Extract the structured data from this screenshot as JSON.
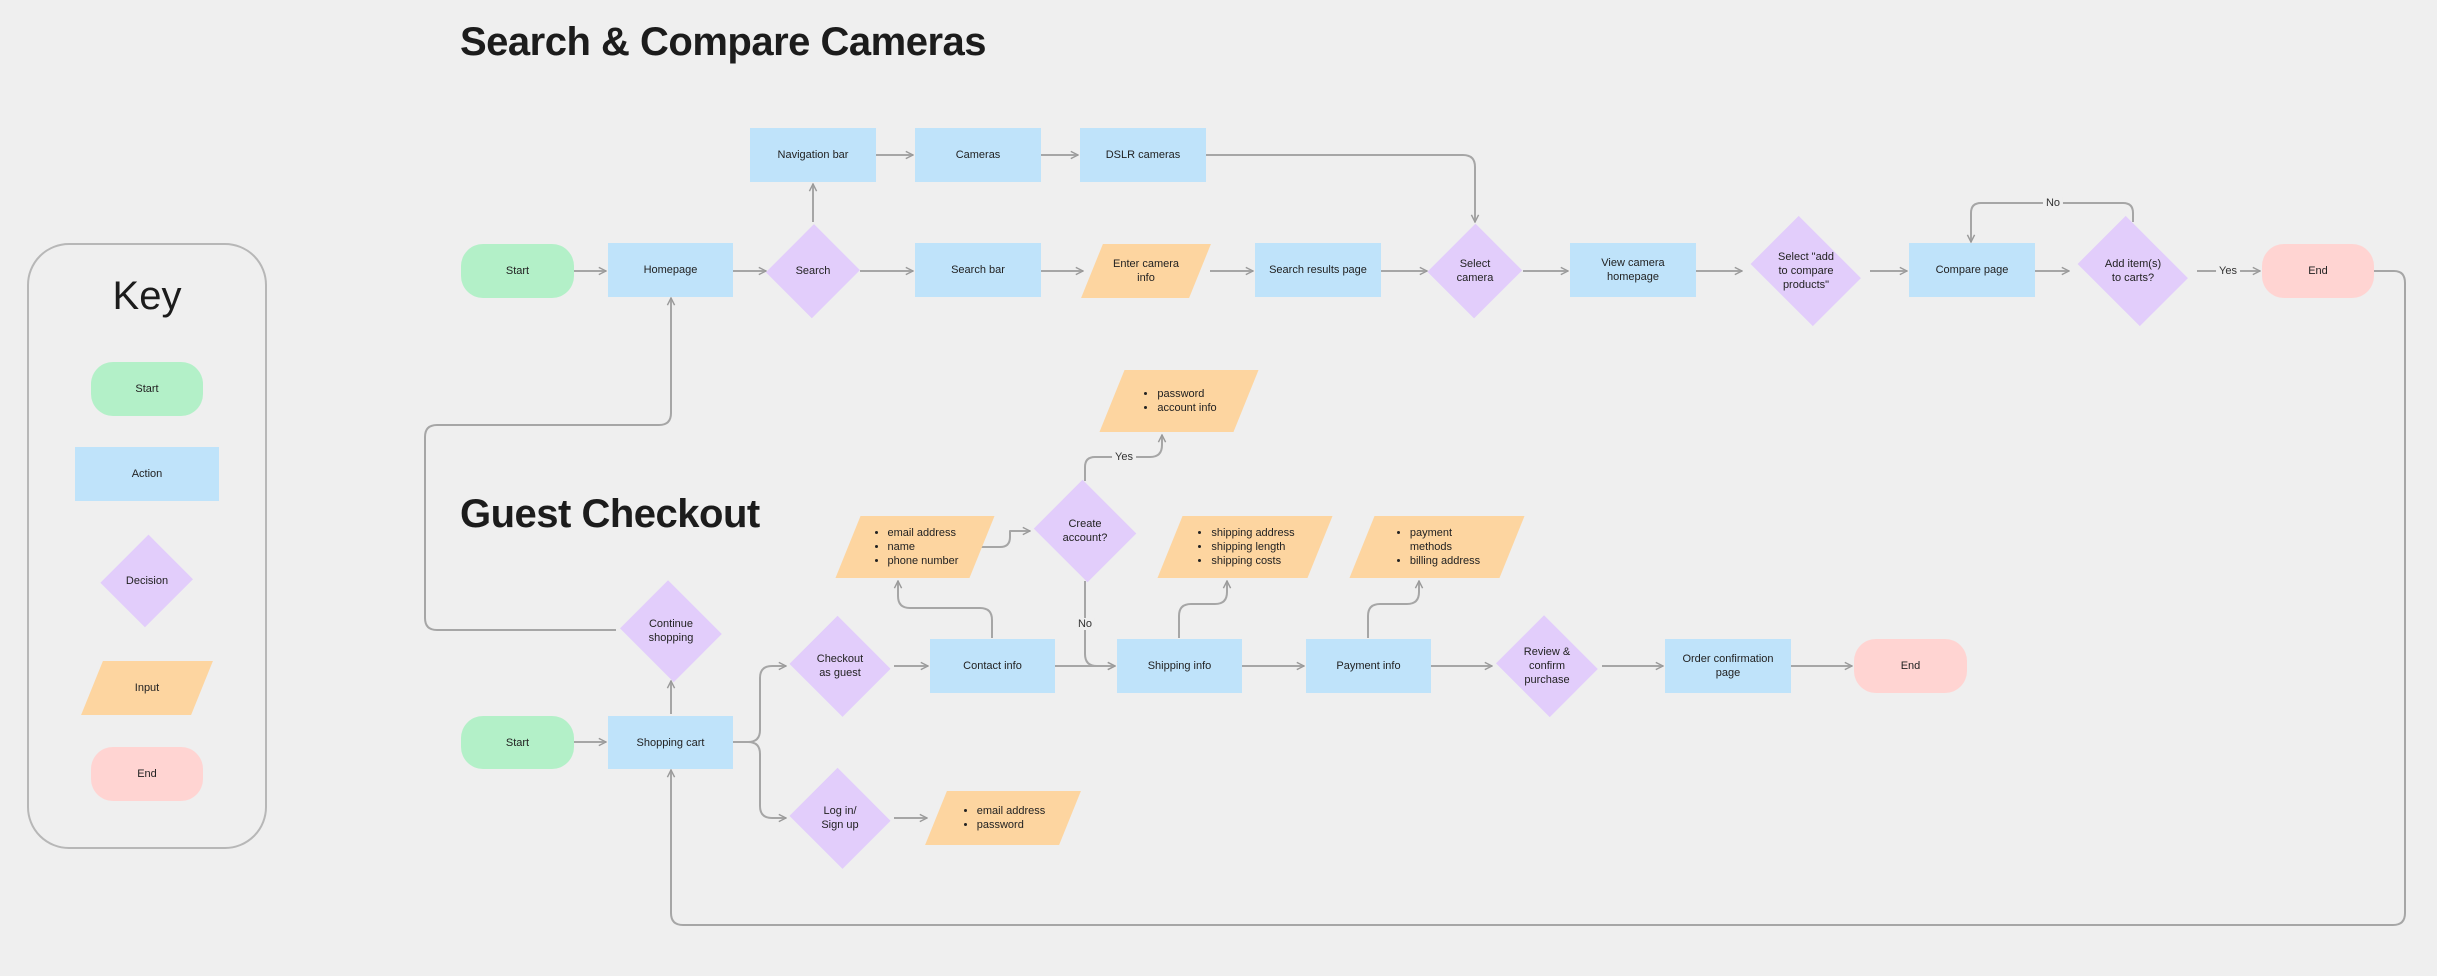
{
  "titles": {
    "search": "Search & Compare Cameras",
    "checkout": "Guest Checkout"
  },
  "key": {
    "title": "Key",
    "start": "Start",
    "action": "Action",
    "decision": "Decision",
    "input": "Input",
    "end": "End"
  },
  "search_flow": {
    "start": "Start",
    "homepage": "Homepage",
    "search": "Search",
    "navigation_bar": "Navigation bar",
    "cameras": "Cameras",
    "dslr_cameras": "DSLR cameras",
    "search_bar": "Search bar",
    "enter_camera_info": "Enter camera\ninfo",
    "search_results_page": "Search results page",
    "select_camera": "Select\ncamera",
    "view_camera_homepage": "View camera\nhomepage",
    "select_add_to_compare": "Select \"add\nto compare\nproducts\"",
    "compare_page": "Compare page",
    "add_items_to_carts": "Add item(s)\nto carts?",
    "end": "End",
    "label_yes": "Yes",
    "label_no": "No"
  },
  "checkout_flow": {
    "start": "Start",
    "shopping_cart": "Shopping cart",
    "continue_shopping": "Continue\nshopping",
    "checkout_as_guest": "Checkout\nas guest",
    "log_in_sign_up": "Log in/\nSign up",
    "login_inputs": [
      "email address",
      "password"
    ],
    "guest_inputs": [
      "email address",
      "name",
      "phone number"
    ],
    "create_account": "Create\naccount?",
    "account_inputs": [
      "password",
      "account info"
    ],
    "contact_info": "Contact info",
    "shipping_info": "Shipping info",
    "shipping_inputs": [
      "shipping address",
      "shipping length",
      "shipping costs"
    ],
    "payment_info": "Payment info",
    "payment_inputs": [
      "payment\nmethods",
      "billing address"
    ],
    "review_confirm_purchase": "Review &\nconfirm\npurchase",
    "order_confirmation_page": "Order confirmation\npage",
    "end": "End",
    "label_yes": "Yes",
    "label_no": "No"
  }
}
